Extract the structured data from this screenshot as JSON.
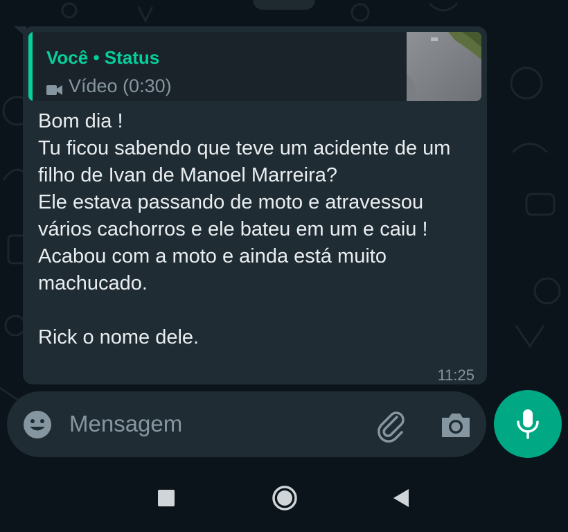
{
  "quote": {
    "author": "Você • Status",
    "media_label": "Vídeo (0:30)",
    "icon": "video-camera-icon"
  },
  "message": {
    "text": "Bom dia !\nTu ficou sabendo que teve um acidente de um filho de Ivan de Manoel Marreira?\nEle estava passando de moto e atravessou vários cachorros e ele bateu em um e caiu !\nAcabou com a moto e ainda está muito machucado.\n\nRick o nome dele.",
    "time": "11:25"
  },
  "composer": {
    "placeholder": "Mensagem",
    "emoji_icon": "emoji-icon",
    "attach_icon": "paperclip-icon",
    "camera_icon": "camera-icon",
    "mic_icon": "microphone-icon"
  },
  "navbar": {
    "recents_icon": "square-icon",
    "home_icon": "circle-icon",
    "back_icon": "triangle-back-icon"
  },
  "colors": {
    "accent": "#00a884",
    "quote_accent": "#06cf9c",
    "bubble": "#1f2c34",
    "background": "#0b141a",
    "text": "#e9edef",
    "muted": "#8696a0"
  }
}
